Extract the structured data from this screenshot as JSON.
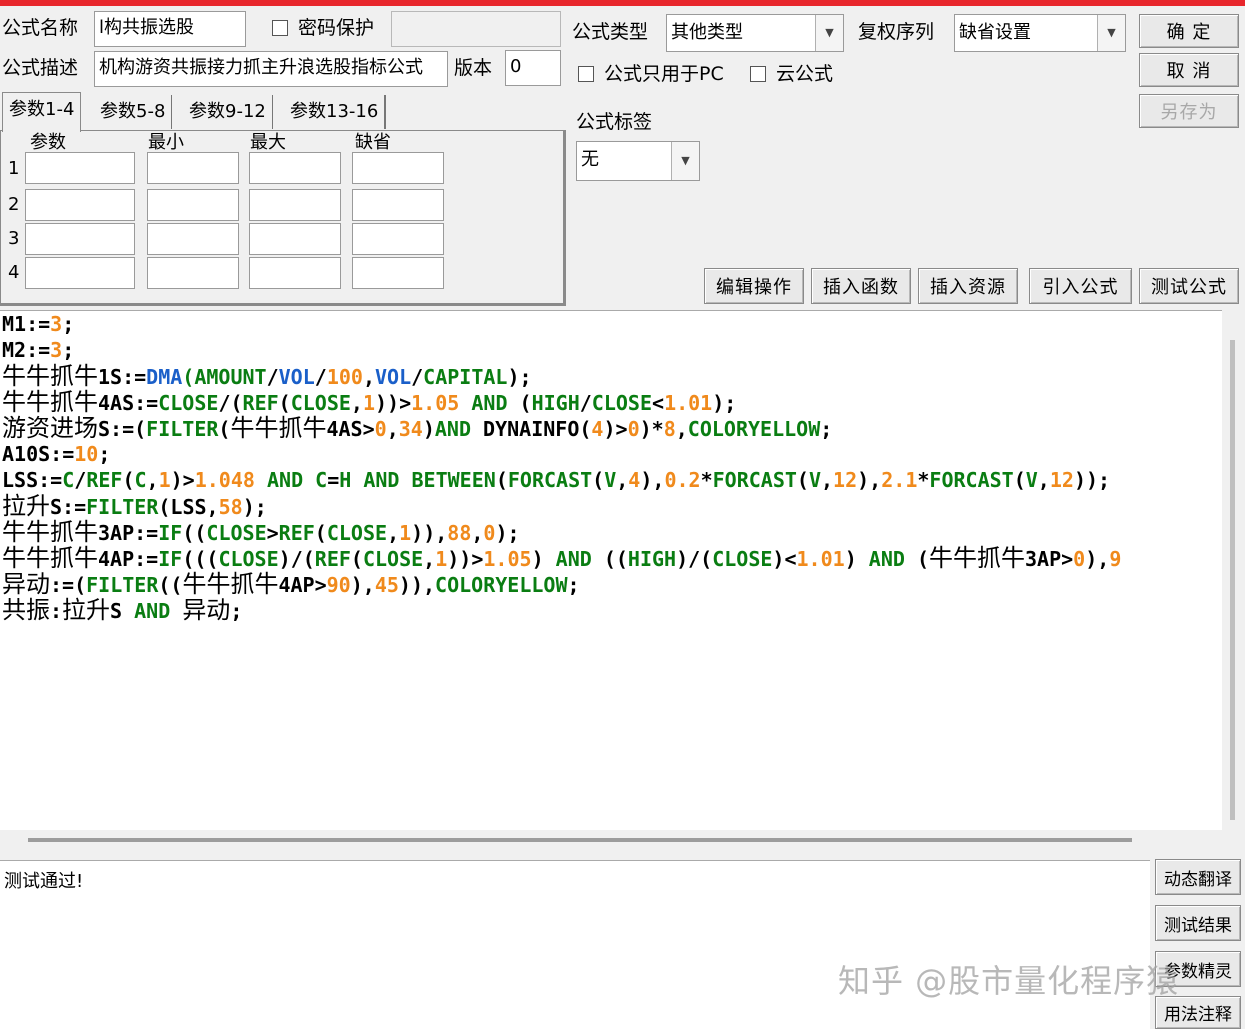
{
  "header": {
    "formula_name_label": "公式名称",
    "formula_name_value": "l构共振选股",
    "password_label": "密码保护",
    "password_value": "",
    "formula_desc_label": "公式描述",
    "formula_desc_value": "机构游资共振接力抓主升浪选股指标公式",
    "version_label": "版本",
    "version_value": "0",
    "formula_type_label": "公式类型",
    "formula_type_value": "其他类型",
    "rights_label": "复权序列",
    "rights_value": "缺省设置",
    "pc_only_label": "公式只用于PC",
    "cloud_label": "云公式",
    "tag_label": "公式标签",
    "tag_value": "无"
  },
  "buttons": {
    "ok": "确  定",
    "cancel": "取  消",
    "save_as": "另存为",
    "edit_ops": "编辑操作",
    "insert_func": "插入函数",
    "insert_res": "插入资源",
    "import_formula": "引入公式",
    "test_formula": "测试公式",
    "dyn_translate": "动态翻译",
    "test_result": "测试结果",
    "param_wizard": "参数精灵",
    "usage_notes": "用法注释"
  },
  "params": {
    "tabs": [
      "参数1-4",
      "参数5-8",
      "参数9-12",
      "参数13-16"
    ],
    "columns": [
      "参数",
      "最小",
      "最大",
      "缺省"
    ],
    "rows": [
      "1",
      "2",
      "3",
      "4"
    ]
  },
  "colors": {
    "keyword": "#0a7d12",
    "number": "#f08a1c",
    "variable": "#1a5fc9",
    "text": "#000000"
  },
  "code_lines": [
    [
      [
        "t",
        "M1:="
      ],
      [
        "n",
        "3"
      ],
      [
        "t",
        ";"
      ]
    ],
    [
      [
        "t",
        "M2:="
      ],
      [
        "n",
        "3"
      ],
      [
        "t",
        ";"
      ]
    ],
    [
      [
        "c",
        "牛牛抓牛"
      ],
      [
        "t",
        "1S:="
      ],
      [
        "v",
        "DMA"
      ],
      [
        "k",
        "("
      ],
      [
        "k",
        "AMOUNT"
      ],
      [
        "t",
        "/"
      ],
      [
        "v",
        "VOL"
      ],
      [
        "t",
        "/"
      ],
      [
        "n",
        "100"
      ],
      [
        "t",
        ","
      ],
      [
        "v",
        "VOL"
      ],
      [
        "t",
        "/"
      ],
      [
        "k",
        "CAPITAL"
      ],
      [
        "t",
        ");"
      ]
    ],
    [
      [
        "c",
        "牛牛抓牛"
      ],
      [
        "t",
        "4AS:="
      ],
      [
        "k",
        "CLOSE"
      ],
      [
        "t",
        "/("
      ],
      [
        "k",
        "REF"
      ],
      [
        "t",
        "("
      ],
      [
        "k",
        "CLOSE"
      ],
      [
        "t",
        ","
      ],
      [
        "n",
        "1"
      ],
      [
        "t",
        "))>"
      ],
      [
        "n",
        "1.05"
      ],
      [
        "t",
        " "
      ],
      [
        "k",
        "AND"
      ],
      [
        "t",
        " ("
      ],
      [
        "k",
        "HIGH"
      ],
      [
        "t",
        "/"
      ],
      [
        "k",
        "CLOSE"
      ],
      [
        "t",
        "<"
      ],
      [
        "n",
        "1.01"
      ],
      [
        "t",
        ");"
      ]
    ],
    [
      [
        "c",
        "游资进场"
      ],
      [
        "t",
        "S:=("
      ],
      [
        "k",
        "FILTER"
      ],
      [
        "t",
        "("
      ],
      [
        "c",
        "牛牛抓牛"
      ],
      [
        "t",
        "4AS>"
      ],
      [
        "n",
        "0"
      ],
      [
        "t",
        ","
      ],
      [
        "n",
        "34"
      ],
      [
        "t",
        ")"
      ],
      [
        "k",
        "AND"
      ],
      [
        "t",
        " DYNAINFO("
      ],
      [
        "n",
        "4"
      ],
      [
        "t",
        ")>"
      ],
      [
        "n",
        "0"
      ],
      [
        "t",
        ")*"
      ],
      [
        "n",
        "8"
      ],
      [
        "t",
        ","
      ],
      [
        "k",
        "COLORYELLOW"
      ],
      [
        "t",
        ";"
      ]
    ],
    [
      [
        "t",
        "A10S:="
      ],
      [
        "n",
        "10"
      ],
      [
        "t",
        ";"
      ]
    ],
    [
      [
        "t",
        "LSS:="
      ],
      [
        "k",
        "C"
      ],
      [
        "t",
        "/"
      ],
      [
        "k",
        "REF"
      ],
      [
        "t",
        "("
      ],
      [
        "k",
        "C"
      ],
      [
        "t",
        ","
      ],
      [
        "n",
        "1"
      ],
      [
        "t",
        ")>"
      ],
      [
        "n",
        "1.048"
      ],
      [
        "t",
        " "
      ],
      [
        "k",
        "AND"
      ],
      [
        "t",
        " "
      ],
      [
        "k",
        "C"
      ],
      [
        "t",
        "="
      ],
      [
        "k",
        "H"
      ],
      [
        "t",
        " "
      ],
      [
        "k",
        "AND"
      ],
      [
        "t",
        " "
      ],
      [
        "k",
        "BETWEEN"
      ],
      [
        "t",
        "("
      ],
      [
        "k",
        "FORCAST"
      ],
      [
        "t",
        "("
      ],
      [
        "k",
        "V"
      ],
      [
        "t",
        ","
      ],
      [
        "n",
        "4"
      ],
      [
        "t",
        "),"
      ],
      [
        "n",
        "0.2"
      ],
      [
        "t",
        "*"
      ],
      [
        "k",
        "FORCAST"
      ],
      [
        "t",
        "("
      ],
      [
        "k",
        "V"
      ],
      [
        "t",
        ","
      ],
      [
        "n",
        "12"
      ],
      [
        "t",
        "),"
      ],
      [
        "n",
        "2.1"
      ],
      [
        "t",
        "*"
      ],
      [
        "k",
        "FORCAST"
      ],
      [
        "t",
        "("
      ],
      [
        "k",
        "V"
      ],
      [
        "t",
        ","
      ],
      [
        "n",
        "12"
      ],
      [
        "t",
        "));"
      ]
    ],
    [
      [
        "c",
        "拉升"
      ],
      [
        "t",
        "S:="
      ],
      [
        "k",
        "FILTER"
      ],
      [
        "t",
        "(LSS,"
      ],
      [
        "n",
        "58"
      ],
      [
        "t",
        ");"
      ]
    ],
    [
      [
        "c",
        "牛牛抓牛"
      ],
      [
        "t",
        "3AP:="
      ],
      [
        "k",
        "IF"
      ],
      [
        "t",
        "(("
      ],
      [
        "k",
        "CLOSE"
      ],
      [
        "t",
        ">"
      ],
      [
        "k",
        "REF"
      ],
      [
        "t",
        "("
      ],
      [
        "k",
        "CLOSE"
      ],
      [
        "t",
        ","
      ],
      [
        "n",
        "1"
      ],
      [
        "t",
        ")),"
      ],
      [
        "n",
        "88"
      ],
      [
        "t",
        ","
      ],
      [
        "n",
        "0"
      ],
      [
        "t",
        ");"
      ]
    ],
    [
      [
        "c",
        "牛牛抓牛"
      ],
      [
        "t",
        "4AP:="
      ],
      [
        "k",
        "IF"
      ],
      [
        "t",
        "((("
      ],
      [
        "k",
        "CLOSE"
      ],
      [
        "t",
        ")/("
      ],
      [
        "k",
        "REF"
      ],
      [
        "t",
        "("
      ],
      [
        "k",
        "CLOSE"
      ],
      [
        "t",
        ","
      ],
      [
        "n",
        "1"
      ],
      [
        "t",
        "))>"
      ],
      [
        "n",
        "1.05"
      ],
      [
        "t",
        ") "
      ],
      [
        "k",
        "AND"
      ],
      [
        "t",
        " (("
      ],
      [
        "k",
        "HIGH"
      ],
      [
        "t",
        ")/("
      ],
      [
        "k",
        "CLOSE"
      ],
      [
        "t",
        ")<"
      ],
      [
        "n",
        "1.01"
      ],
      [
        "t",
        ") "
      ],
      [
        "k",
        "AND"
      ],
      [
        "t",
        " ("
      ],
      [
        "c",
        "牛牛抓牛"
      ],
      [
        "t",
        "3AP>"
      ],
      [
        "n",
        "0"
      ],
      [
        "t",
        "),"
      ],
      [
        "n",
        "9"
      ]
    ],
    [
      [
        "c",
        "异动"
      ],
      [
        "t",
        ":=("
      ],
      [
        "k",
        "FILTER"
      ],
      [
        "t",
        "(("
      ],
      [
        "c",
        "牛牛抓牛"
      ],
      [
        "t",
        "4AP>"
      ],
      [
        "n",
        "90"
      ],
      [
        "t",
        "),"
      ],
      [
        "n",
        "45"
      ],
      [
        "t",
        ")),"
      ],
      [
        "k",
        "COLORYELLOW"
      ],
      [
        "t",
        ";"
      ]
    ],
    [
      [
        "c",
        "共振"
      ],
      [
        "t",
        ":"
      ],
      [
        "c",
        "拉升"
      ],
      [
        "t",
        "S "
      ],
      [
        "k",
        "AND"
      ],
      [
        "t",
        " "
      ],
      [
        "c",
        "异动"
      ],
      [
        "t",
        ";"
      ]
    ]
  ],
  "output": {
    "message": "测试通过!"
  },
  "watermark": "知乎 @股市量化程序猿"
}
